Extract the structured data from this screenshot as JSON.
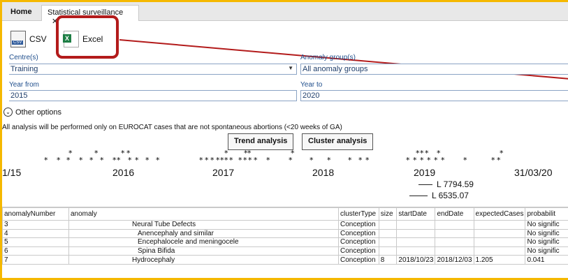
{
  "tabs": {
    "home": "Home",
    "active": "Statistical surveillance",
    "close": "✕"
  },
  "toolbar": {
    "csv_label": "CSV",
    "csv_icon_text": "CSV",
    "excel_label": "Excel",
    "excel_icon_text": "X"
  },
  "form": {
    "centres_label": "Centre(s)",
    "centres_value": "Training",
    "anomaly_group_label": "Anomaly group(s)",
    "anomaly_group_value": "All anomaly groups",
    "year_from_label": "Year from",
    "year_from_value": "2015",
    "year_to_label": "Year to",
    "year_to_value": "2020",
    "other_options": "Other options",
    "note": "All analysis will be performed only on EUROCAT cases that are not spontaneous abortions (<20 weeks of GA)"
  },
  "buttons": {
    "trend": "Trend analysis",
    "cluster": "Cluster analysis"
  },
  "timeline": {
    "ticks": [
      "1/15",
      "2016",
      "2017",
      "2018",
      "2019",
      "31/03/20"
    ],
    "legend": [
      "L 7794.59",
      "L 6535.07"
    ]
  },
  "table": {
    "headers": [
      "anomalyNumber",
      "anomaly",
      "clusterType",
      "size",
      "startDate",
      "endDate",
      "expectedCases",
      "probabilit"
    ],
    "rows": [
      [
        "3",
        "Neural Tube Defects",
        "Conception",
        "",
        "",
        "",
        "",
        "No signific"
      ],
      [
        "4",
        "Anencephaly and similar",
        "Conception",
        "",
        "",
        "",
        "",
        "No signific"
      ],
      [
        "5",
        "Encephalocele and meningocele",
        "Conception",
        "",
        "",
        "",
        "",
        "No signific"
      ],
      [
        "6",
        "Spina Bifida",
        "Conception",
        "",
        "",
        "",
        "",
        "No signific"
      ],
      [
        "7",
        "Hydrocephaly",
        "Conception",
        "8",
        "2018/10/23",
        "2018/12/03",
        "1.205",
        "0.041"
      ]
    ]
  },
  "colors": {
    "frame_border": "#f5b800",
    "highlight": "#b31b1b",
    "link_blue": "#1f4e8c",
    "excel_green": "#1e7e45"
  }
}
